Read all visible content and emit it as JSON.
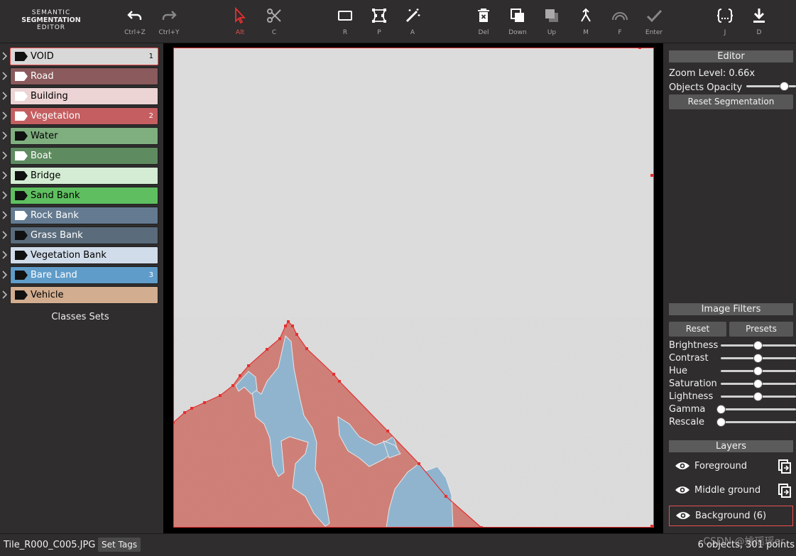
{
  "app": {
    "logo_line1": "SEMANTIC",
    "logo_line2": "SEGMENTATION",
    "logo_line3": "EDITOR"
  },
  "toolbar": {
    "undo": {
      "icon": "undo-icon",
      "hotkey": "Ctrl+Z"
    },
    "redo": {
      "icon": "redo-icon",
      "hotkey": "Ctrl+Y"
    },
    "select": {
      "icon": "cursor-icon",
      "hotkey": "Alt"
    },
    "cut": {
      "icon": "scissors-icon",
      "hotkey": "C"
    },
    "rect": {
      "icon": "rectangle-icon",
      "hotkey": "R"
    },
    "polygon": {
      "icon": "polygon-icon",
      "hotkey": "P"
    },
    "auto": {
      "icon": "magic-wand-icon",
      "hotkey": "A"
    },
    "delete": {
      "icon": "trash-icon",
      "hotkey": "Del"
    },
    "down": {
      "icon": "send-backward-icon",
      "hotkey": "Down"
    },
    "up": {
      "icon": "bring-forward-icon",
      "hotkey": "Up"
    },
    "merge": {
      "icon": "merge-icon",
      "hotkey": "M"
    },
    "fill": {
      "icon": "rainbow-icon",
      "hotkey": "F"
    },
    "enter": {
      "icon": "checkmark-icon",
      "hotkey": "Enter"
    },
    "json": {
      "icon": "json-braces-icon",
      "hotkey": "J"
    },
    "download": {
      "icon": "download-icon",
      "hotkey": "D"
    }
  },
  "classes": [
    {
      "name": "VOID",
      "color": "#d8d8d8",
      "text": "#000000",
      "tag": "#111111",
      "count": "1",
      "selected": true
    },
    {
      "name": "Road",
      "color": "#8a5a5c",
      "text": "#ffffff",
      "tag": "#ffffff",
      "count": ""
    },
    {
      "name": "Building",
      "color": "#ecd3d4",
      "text": "#000000",
      "tag": "#ffffff",
      "count": ""
    },
    {
      "name": "Vegetation",
      "color": "#c45e60",
      "text": "#ffffff",
      "tag": "#ffffff",
      "count": "2"
    },
    {
      "name": "Water",
      "color": "#7fae7f",
      "text": "#000000",
      "tag": "#111111",
      "count": ""
    },
    {
      "name": "Boat",
      "color": "#5e8b60",
      "text": "#ffffff",
      "tag": "#ffffff",
      "count": ""
    },
    {
      "name": "Bridge",
      "color": "#d3ecd3",
      "text": "#000000",
      "tag": "#111111",
      "count": ""
    },
    {
      "name": "Sand Bank",
      "color": "#5fbf60",
      "text": "#000000",
      "tag": "#111111",
      "count": ""
    },
    {
      "name": "Rock Bank",
      "color": "#637a91",
      "text": "#ffffff",
      "tag": "#ffffff",
      "count": ""
    },
    {
      "name": "Grass Bank",
      "color": "#5a6b7c",
      "text": "#ffffff",
      "tag": "#111111",
      "count": ""
    },
    {
      "name": "Vegetation Bank",
      "color": "#d1dcea",
      "text": "#000000",
      "tag": "#111111",
      "count": ""
    },
    {
      "name": "Bare Land",
      "color": "#5f9cc9",
      "text": "#ffffff",
      "tag": "#111111",
      "count": "3"
    },
    {
      "name": "Vehicle",
      "color": "#d2ad8f",
      "text": "#000000",
      "tag": "#111111",
      "count": ""
    }
  ],
  "classes_sets_label": "Classes Sets",
  "editor": {
    "header": "Editor",
    "zoom_label": "Zoom Level: 0.66x",
    "opacity_label": "Objects Opacity",
    "opacity_value": 0.75,
    "reset_segmentation": "Reset Segmentation"
  },
  "filters": {
    "header": "Image Filters",
    "reset": "Reset",
    "presets": "Presets",
    "items": [
      {
        "label": "Brightness",
        "value": 0.5
      },
      {
        "label": "Contrast",
        "value": 0.5
      },
      {
        "label": "Hue",
        "value": 0.5
      },
      {
        "label": "Saturation",
        "value": 0.5
      },
      {
        "label": "Lightness",
        "value": 0.5
      },
      {
        "label": "Gamma",
        "value": 0.0
      },
      {
        "label": "Rescale",
        "value": 0.0
      }
    ]
  },
  "layers": {
    "header": "Layers",
    "items": [
      {
        "name": "Foreground",
        "icon": "eye-icon"
      },
      {
        "name": "Middle ground",
        "icon": "eye-icon"
      },
      {
        "name": "Background (6)",
        "icon": "eye-icon",
        "selected": true
      }
    ]
  },
  "status": {
    "filename": "Tile_R000_C005.JPG",
    "set_tags": "Set Tags",
    "summary": "6 objects, 301 points",
    "watermark": "CSDN @姚瑶瑶er"
  },
  "colors": {
    "void_fill": "#dcdcdc",
    "vegetation_fill": "#cf7e76",
    "bare_land_fill": "#8fb4cf",
    "accent": "#e53030"
  }
}
